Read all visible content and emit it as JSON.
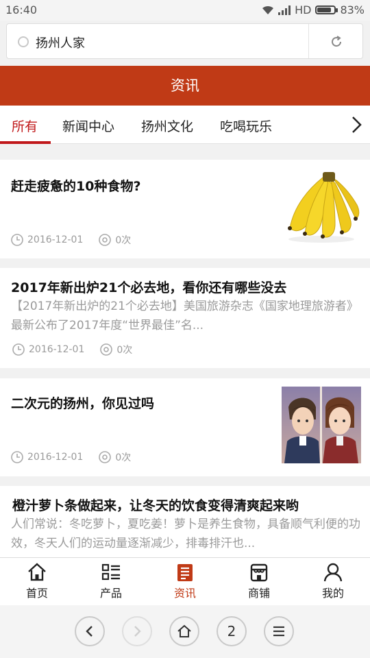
{
  "status_bar": {
    "time": "16:40",
    "network": "HD",
    "battery": "83%",
    "battery_level": 0.83
  },
  "browser": {
    "url_text": "扬州人家",
    "tab_count": "2"
  },
  "header": {
    "title": "资讯"
  },
  "tabs": [
    {
      "label": "所有",
      "active": true
    },
    {
      "label": "新闻中心"
    },
    {
      "label": "扬州文化"
    },
    {
      "label": "吃喝玩乐"
    }
  ],
  "articles": [
    {
      "title": "赶走疲惫的10种食物?",
      "date": "2016-12-01",
      "views": "0次",
      "thumbnail": "banana-image"
    },
    {
      "title": "2017年新出炉21个必去地，看你还有哪些没去",
      "summary": "【2017年新出炉的21个必去地】美国旅游杂志《国家地理旅游者》最新公布了2017年度“世界最佳”名...",
      "date": "2016-12-01",
      "views": "0次"
    },
    {
      "title": "二次元的扬州，你见过吗",
      "date": "2016-12-01",
      "views": "0次",
      "thumbnail": "anime-image"
    },
    {
      "title": "橙汁萝卜条做起来，让冬天的饮食变得清爽起来哟",
      "summary": "人们常说：冬吃萝卜，夏吃姜！萝卜是养生食物，具备顺气利便的功效，冬天人们的运动量逐渐减少，排毒排汗也..."
    }
  ],
  "bottom_nav": [
    {
      "label": "首页",
      "icon": "home-icon"
    },
    {
      "label": "产品",
      "icon": "grid-list-icon"
    },
    {
      "label": "资讯",
      "icon": "news-icon",
      "active": true
    },
    {
      "label": "商铺",
      "icon": "shop-icon"
    },
    {
      "label": "我的",
      "icon": "user-icon"
    }
  ],
  "colors": {
    "brand": "#c03a16",
    "active_tab": "#c0181a"
  }
}
